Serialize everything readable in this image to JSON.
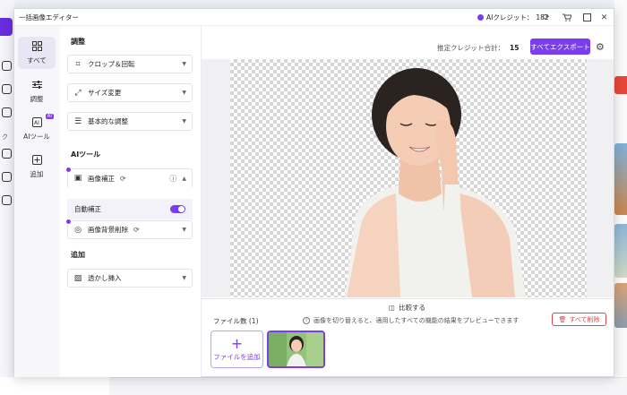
{
  "window": {
    "title": "一括画像エディター",
    "ai_credit_label": "AIクレジット：",
    "ai_credit_value": "182"
  },
  "sidebar": {
    "items": [
      {
        "label": "すべて"
      },
      {
        "label": "調整"
      },
      {
        "label": "AIツール",
        "badge": "AI"
      },
      {
        "label": "追加"
      }
    ]
  },
  "background": {
    "left_text": "ク"
  },
  "panel": {
    "adjust_section": "調整",
    "crop_rotate": "クロップ＆回転",
    "resize": "サイズ変更",
    "basic_adjust": "基本的な調整",
    "ai_section": "AIツール",
    "image_correction": "画像補正",
    "auto_correct": "自動補正",
    "bg_remove": "画像背景削除",
    "add_section": "追加",
    "watermark": "透かし挿入"
  },
  "main": {
    "estimated_label": "推定クレジット合計：",
    "estimated_value": "15",
    "export_all": "すべてエクスポート",
    "compare": "比較する",
    "file_count": "ファイル数 (1)",
    "hint": "画像を切り替えると、適用したすべての機能の結果をプレビューできます",
    "delete_all": "すべて削除",
    "add_file": "ファイルを追加"
  },
  "colors": {
    "accent": "#7b3cf0",
    "danger": "#e04848"
  }
}
